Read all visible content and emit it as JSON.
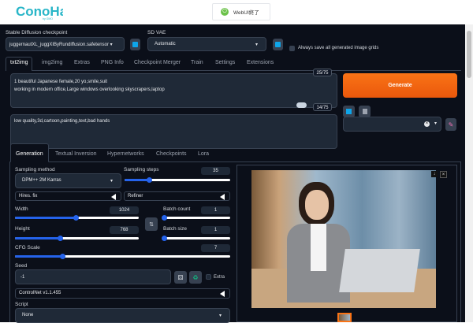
{
  "header": {
    "logo": "ConoHa",
    "logo_sub": "by GMO",
    "stop_button": "WebUI終了"
  },
  "top": {
    "checkpoint_label": "Stable Diffusion checkpoint",
    "checkpoint_value": "juggernautXL_juggXIByRundiffusion.safetensor",
    "vae_label": "SD VAE",
    "vae_value": "Automatic",
    "always_save_label": "Always save all generated image grids"
  },
  "tabs": [
    "txt2img",
    "img2img",
    "Extras",
    "PNG Info",
    "Checkpoint Merger",
    "Train",
    "Settings",
    "Extensions"
  ],
  "prompt": {
    "value": "1 beautiful Japanese female,20 yo,smile,suit\nworking in modern office,Large windows overlooking skyscrapers,laptop",
    "counter": "25/75"
  },
  "negative": {
    "value": "low quality,3d,cartoon,painting,text,bad hands",
    "counter": "14/75"
  },
  "generate_label": "Generate",
  "subtabs": [
    "Generation",
    "Textual Inversion",
    "Hypernetworks",
    "Checkpoints",
    "Lora"
  ],
  "params": {
    "sampling_method_label": "Sampling method",
    "sampling_method": "DPM++ 2M Karras",
    "steps_label": "Sampling steps",
    "steps": "35",
    "steps_frac": 0.23,
    "hires_label": "Hires. fix",
    "refiner_label": "Refiner",
    "width_label": "Width",
    "width": "1024",
    "width_frac": 0.49,
    "height_label": "Height",
    "height": "768",
    "height_frac": 0.36,
    "batch_count_label": "Batch count",
    "batch_count": "1",
    "batch_count_frac": 0,
    "batch_size_label": "Batch size",
    "batch_size": "1",
    "batch_size_frac": 0,
    "cfg_label": "CFG Scale",
    "cfg": "7",
    "cfg_frac": 0.22,
    "seed_label": "Seed",
    "seed": "-1",
    "extra_label": "Extra",
    "controlnet_label": "ControlNet v1.1.455",
    "script_label": "Script",
    "script": "None"
  },
  "colors": {
    "accent": "#f97316",
    "slider": "#2563eb",
    "bg": "#0b0f19"
  }
}
